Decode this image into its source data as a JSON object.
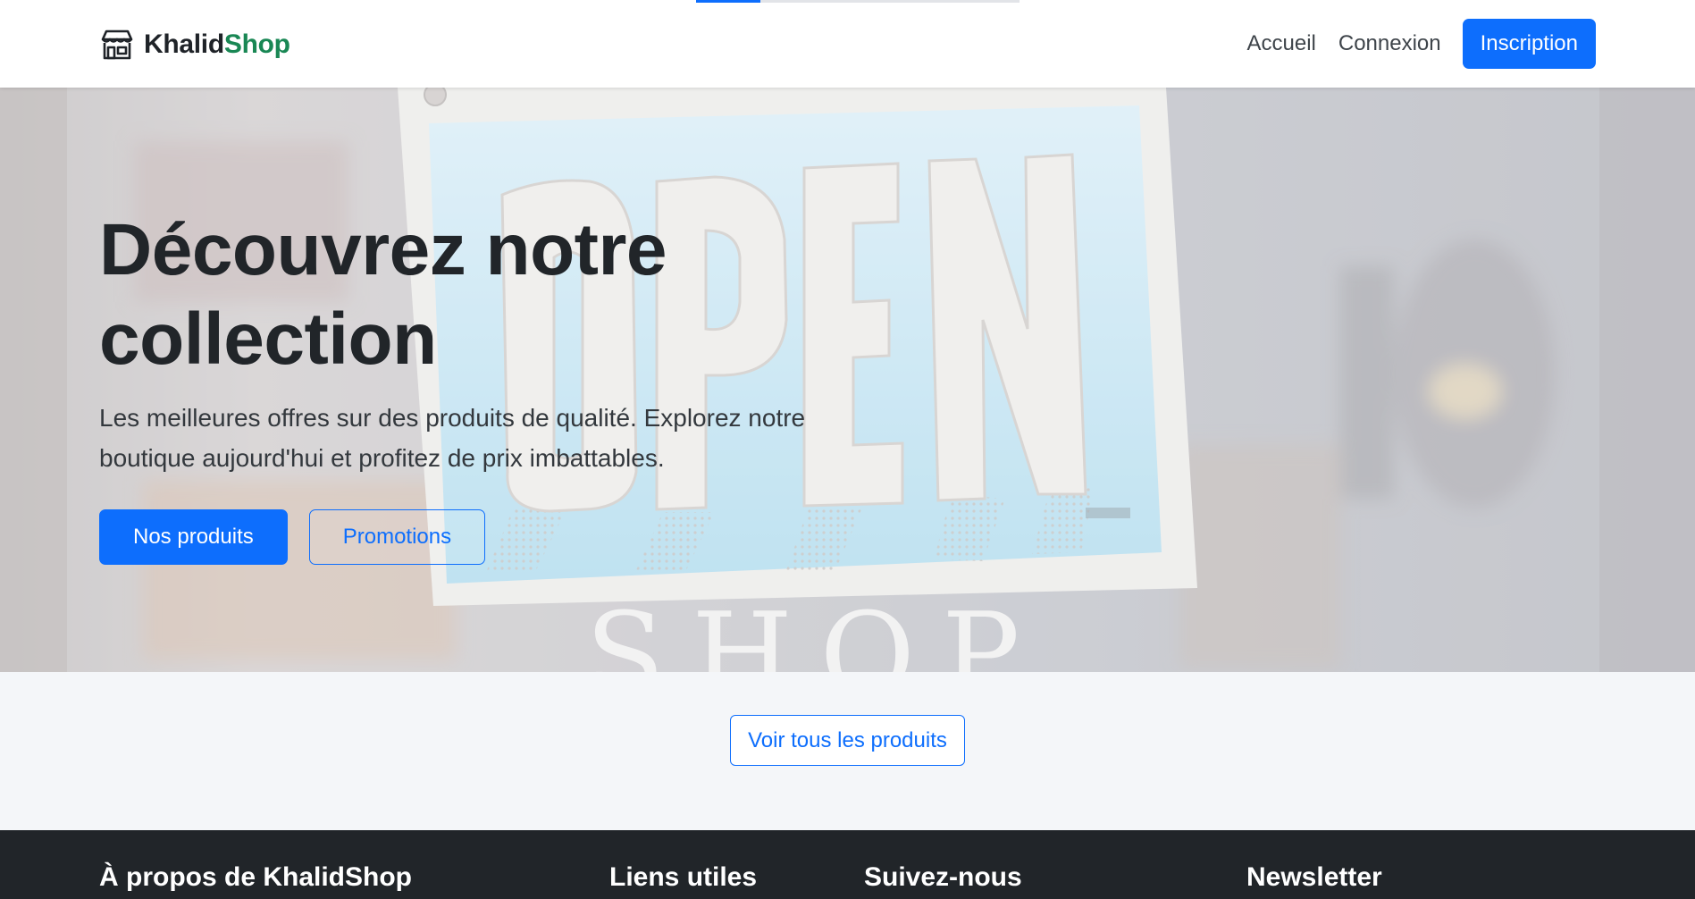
{
  "navbar": {
    "loading_progress": 0.2,
    "brand": {
      "part1": "Khalid",
      "part2": "Shop",
      "icon": "store-icon"
    },
    "links": {
      "home": "Accueil",
      "login": "Connexion"
    },
    "signup_label": "Inscription"
  },
  "hero": {
    "title": "Découvrez notre collection",
    "subtitle": "Les meilleures offres sur des produits de qualité. Explorez notre boutique aujourd'hui et profitez de prix imbattables.",
    "primary_button": "Nos produits",
    "secondary_button": "Promotions",
    "background_sign": {
      "sign_text": "OPEN",
      "below_text": "SHOP"
    }
  },
  "products": {
    "view_all_button": "Voir tous les produits"
  },
  "footer": {
    "about_heading": "À propos de KhalidShop",
    "links_heading": "Liens utiles",
    "follow_heading": "Suivez-nous",
    "newsletter_heading": "Newsletter"
  },
  "colors": {
    "primary": "#0d6efd",
    "brand_green": "#198754",
    "footer_bg": "#212529",
    "strip_bg": "#f4f6f9"
  }
}
